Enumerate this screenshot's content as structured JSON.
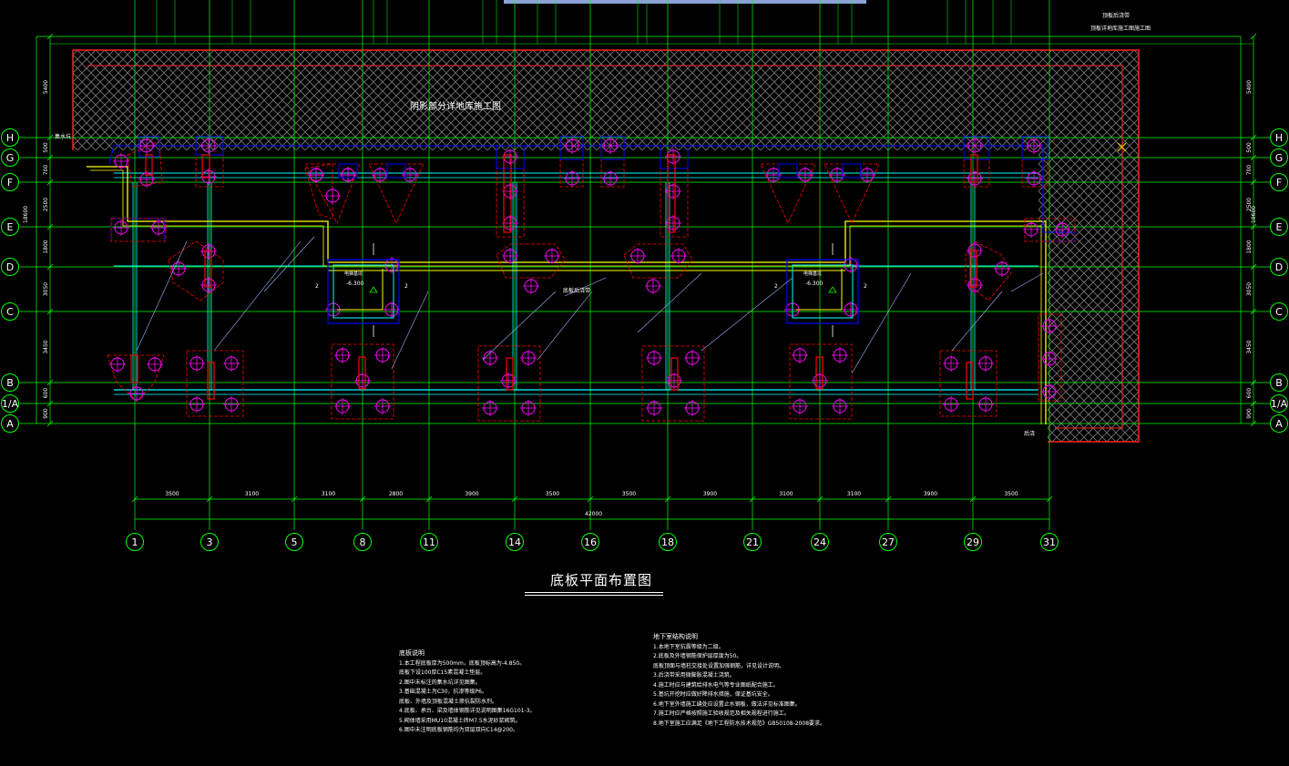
{
  "drawing": {
    "title": "底板平面布置图",
    "hatch_label": "阴影部分详地库施工图",
    "corner_note_1": "顶板后浇带",
    "corner_note_2": "顶板详地库施工图施工图",
    "left_note": "集水坑",
    "bottom_right_note": "后浇",
    "mid_label": "底板后浇带",
    "pit_label": "-6.300",
    "pit_title": "电梯基坑",
    "section_mark": "2",
    "total_dim": "42000",
    "colors": {
      "background": "#000000",
      "grid": "#00ff00",
      "wall_cyan": "#00ffff",
      "foundation": "#ff0000",
      "outline_blue": "#0000ff",
      "column": "#ff00ff",
      "yellow": "#ffff00",
      "hatch": "#808080"
    }
  },
  "axes": {
    "vertical": [
      "1",
      "3",
      "5",
      "8",
      "11",
      "14",
      "16",
      "18",
      "21",
      "24",
      "27",
      "29",
      "31"
    ],
    "horizontal": [
      "H",
      "G",
      "F",
      "E",
      "D",
      "C",
      "B",
      "1/A",
      "A"
    ]
  },
  "dims": {
    "bottom": [
      "3500",
      "3100",
      "3100",
      "2800",
      "3900",
      "3500",
      "3500",
      "3900",
      "3100",
      "3100",
      "3900",
      "3500"
    ],
    "left": [
      "5400",
      "500",
      "700",
      "2500",
      "1800",
      "3050",
      "3450",
      "600",
      "900"
    ],
    "left_total": "18600"
  },
  "notes_left": {
    "heading": "底板说明",
    "lines": [
      "1.本工程底板厚为500mm，底板顶标高为-4.850。",
      "底板下设100厚C15素混凝土垫层。",
      "2.图中未标注的集水坑详见图集。",
      "3.基础混凝土为C30，抗渗等级P6。",
      "底板、外墙及顶板混凝土掺抗裂防水剂。",
      "4.底板、承台、梁及墙体钢筋详见说明图集16G101-3。",
      "5.砌体墙采用MU10混凝土砖M7.5水泥砂浆砌筑。",
      "6.图中未注明底板钢筋均为双层双向C14@200。"
    ]
  },
  "notes_right": {
    "heading": "地下室结构说明",
    "lines": [
      "1.本地下室抗震等级为二级。",
      "2.底板及外墙钢筋保护层厚度为50。",
      "底板顶面与墙柱交接处设置加强钢筋，详见设计说明。",
      "3.后浇带采用微膨胀混凝土浇筑。",
      "4.施工时应与建筑给排水电气等专业图纸配合施工。",
      "5.基坑开挖时应做好降排水措施，保证基坑安全。",
      "6.地下室外墙施工缝处应设置止水钢板，做法详见标准图集。",
      "7.施工时应严格按照施工验收规范及相关规程进行施工。",
      "8.地下室施工应满足《地下工程防水技术规范》GB50108-2008要求。"
    ]
  }
}
